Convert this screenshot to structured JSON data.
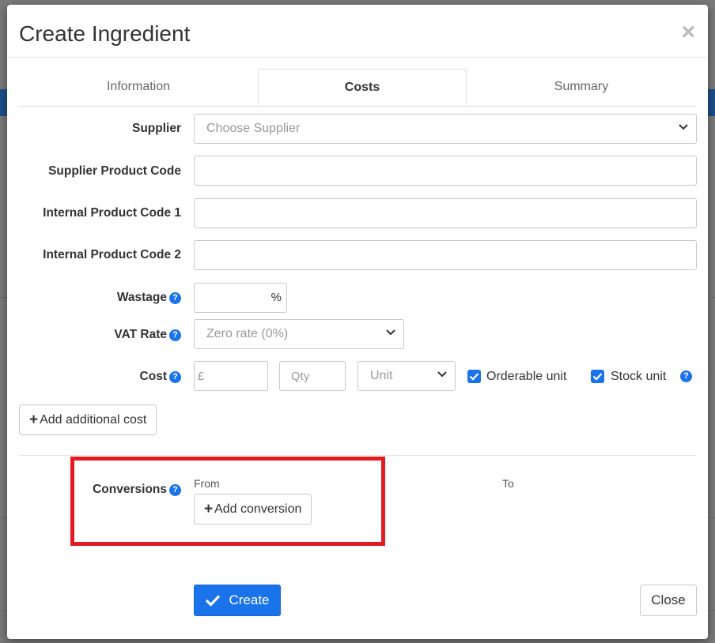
{
  "dialog": {
    "title": "Create Ingredient",
    "close_symbol": "×"
  },
  "tabs": [
    {
      "label": "Information",
      "active": false
    },
    {
      "label": "Costs",
      "active": true
    },
    {
      "label": "Summary",
      "active": false
    }
  ],
  "form": {
    "supplier": {
      "label": "Supplier",
      "placeholder": "Choose Supplier"
    },
    "supplier_product_code": {
      "label": "Supplier Product Code",
      "value": ""
    },
    "internal_product_code_1": {
      "label": "Internal Product Code 1",
      "value": ""
    },
    "internal_product_code_2": {
      "label": "Internal Product Code 2",
      "value": ""
    },
    "wastage": {
      "label": "Wastage",
      "value": "",
      "suffix": "%"
    },
    "vat_rate": {
      "label": "VAT Rate",
      "selected": "Zero rate (0%)"
    },
    "cost": {
      "label": "Cost",
      "price_prefix": "£",
      "qty_placeholder": "Qty",
      "unit_selected": "Unit",
      "orderable_unit_label": "Orderable unit",
      "orderable_unit_checked": true,
      "stock_unit_label": "Stock unit",
      "stock_unit_checked": true
    },
    "add_additional_cost_label": "Add additional cost"
  },
  "conversions": {
    "label": "Conversions",
    "from_label": "From",
    "to_label": "To",
    "add_conversion_label": "Add conversion"
  },
  "footer": {
    "create_label": "Create",
    "close_label": "Close"
  },
  "colors": {
    "accent": "#1a73e8",
    "highlight_border": "#e21b23"
  },
  "icons": {
    "help": "question-circle-icon",
    "check": "check-icon",
    "plus": "plus-icon",
    "chevron": "chevron-down-icon"
  }
}
